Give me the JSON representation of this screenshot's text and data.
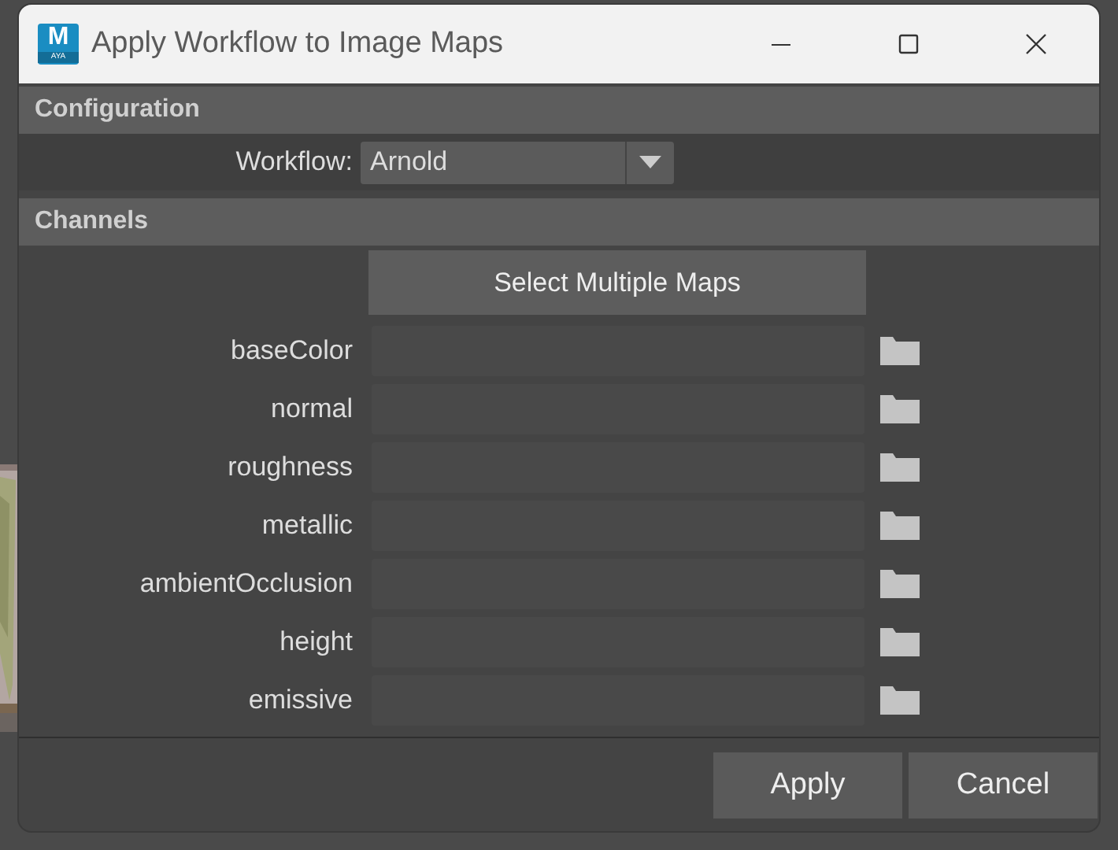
{
  "window": {
    "title": "Apply Workflow to Image Maps",
    "app_icon": {
      "letter": "M",
      "caption": "AYA"
    }
  },
  "configuration": {
    "heading": "Configuration",
    "workflow": {
      "label": "Workflow:",
      "value": "Arnold"
    }
  },
  "channels": {
    "heading": "Channels",
    "select_button": "Select Multiple Maps",
    "items": [
      {
        "label": "baseColor"
      },
      {
        "label": "normal"
      },
      {
        "label": "roughness"
      },
      {
        "label": "metallic"
      },
      {
        "label": "ambientOcclusion"
      },
      {
        "label": "height"
      },
      {
        "label": "emissive"
      }
    ]
  },
  "buttons": [
    "Apply",
    "Cancel"
  ]
}
